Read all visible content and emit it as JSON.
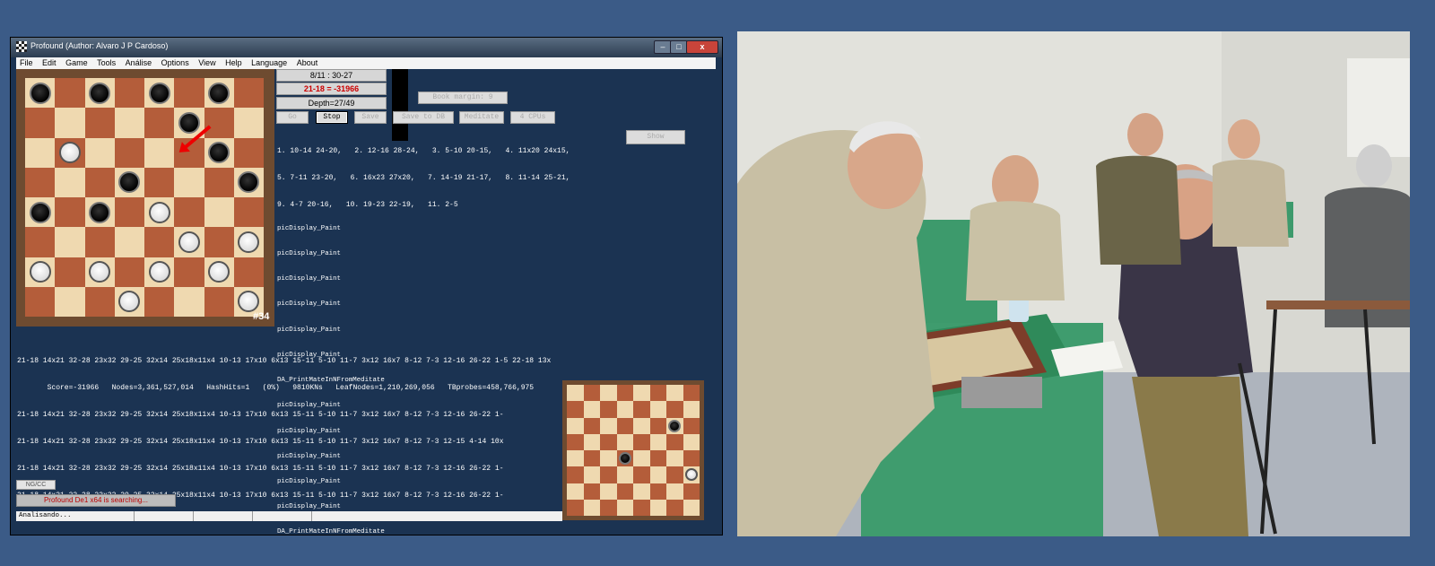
{
  "window": {
    "title": "Profound (Author: Alvaro J P Cardoso)",
    "close_label": "x",
    "min_label": "–",
    "max_label": "□"
  },
  "menu": [
    "File",
    "Edit",
    "Game",
    "Tools",
    "Análise",
    "Options",
    "View",
    "Help",
    "Language",
    "About"
  ],
  "board_main": {
    "move_number": "#34",
    "rows": [
      [
        "b",
        ".",
        "b",
        ".",
        "b",
        ".",
        "b",
        "."
      ],
      [
        ".",
        ".",
        ".",
        ".",
        ".",
        "b",
        ".",
        "."
      ],
      [
        ".",
        "w",
        ".",
        ".",
        ".",
        ".",
        "b",
        "."
      ],
      [
        ".",
        ".",
        ".",
        "b",
        ".",
        ".",
        ".",
        "b"
      ],
      [
        "b",
        ".",
        "b",
        ".",
        "w",
        ".",
        ".",
        "."
      ],
      [
        ".",
        ".",
        ".",
        ".",
        ".",
        "w",
        ".",
        "w"
      ],
      [
        "w",
        ".",
        "w",
        ".",
        "w",
        ".",
        "w",
        "."
      ],
      [
        ".",
        ".",
        ".",
        "w",
        ".",
        ".",
        ".",
        "w"
      ]
    ]
  },
  "board_small": {
    "rows": [
      [
        ".",
        ".",
        ".",
        ".",
        ".",
        ".",
        ".",
        "."
      ],
      [
        ".",
        ".",
        ".",
        ".",
        ".",
        ".",
        ".",
        "."
      ],
      [
        ".",
        ".",
        ".",
        ".",
        ".",
        ".",
        "b",
        "."
      ],
      [
        ".",
        ".",
        ".",
        ".",
        ".",
        ".",
        ".",
        "."
      ],
      [
        ".",
        ".",
        ".",
        "b",
        ".",
        ".",
        ".",
        "."
      ],
      [
        ".",
        ".",
        ".",
        ".",
        ".",
        ".",
        ".",
        "w"
      ],
      [
        ".",
        ".",
        ".",
        ".",
        ".",
        ".",
        ".",
        "."
      ],
      [
        ".",
        ".",
        ".",
        ".",
        ".",
        ".",
        ".",
        "."
      ]
    ]
  },
  "info": {
    "position": "8/11 : 30-27",
    "score": "21-18 = -31966",
    "depth": "Depth=27/49",
    "book_margin": "Book margin: 9"
  },
  "colors": {
    "score": "#cc0000",
    "status": "#bb0000",
    "dark_square": "#b45d3a",
    "light_square": "#efd9b0"
  },
  "buttons": {
    "go": "Go",
    "stop": "Stop",
    "save": "Save",
    "save_db": "Save to DB",
    "meditate": "Meditate",
    "cpus": "4 CPUs",
    "show": "Show",
    "ngcc": "NG/CC"
  },
  "pv_lines": [
    "1. 10-14 24-20,   2. 12-16 28-24,   3. 5-10 20-15,   4. 11x20 24x15,",
    "5. 7-11 23-20,   6. 16x23 27x20,   7. 14-19 21-17,   8. 11-14 25-21,",
    "9. 4-7 20-16,   10. 19-23 22-19,   11. 2-5"
  ],
  "log_lines": [
    "picDisplay_Paint",
    "picDisplay_Paint",
    "picDisplay_Paint",
    "picDisplay_Paint",
    "picDisplay_Paint",
    "picDisplay_Paint",
    "DA_PrintMateInNFromMeditate",
    "picDisplay_Paint",
    "picDisplay_Paint",
    "picDisplay_Paint",
    "picDisplay_Paint",
    "picDisplay_Paint",
    "DA_PrintMateInNFromMeditate"
  ],
  "analysis_line1": "21-18 14x21 32-28 23x32 29-25 32x14 25x18x11x4 10-13 17x10 6x13 15-11 5-10 11-7 3x12 16x7 8-12 7-3 12-16 26-22 1-5 22-18 13x",
  "analysis_stats": "       Score=-31966   Nodes=3,361,527,014   HashHits=1   (0%)   9810KNs   LeafNodes=1,210,269,056   TBprobes=458,766,975",
  "analysis_lines": [
    "21-18 14x21 32-28 23x32 29-25 32x14 25x18x11x4 10-13 17x10 6x13 15-11 5-10 11-7 3x12 16x7 8-12 7-3 12-16 26-22 1-",
    "21-18 14x21 32-28 23x32 29-25 32x14 25x18x11x4 10-13 17x10 6x13 15-11 5-10 11-7 3x12 16x7 8-12 7-3 12-15 4-14 10x",
    "21-18 14x21 32-28 23x32 29-25 32x14 25x18x11x4 10-13 17x10 6x13 15-11 5-10 11-7 3x12 16x7 8-12 7-3 12-16 26-22 1-",
    "21-18 14x21 32-28 23x32 29-25 32x14 25x18x11x4 10-13 17x10 6x13 15-11 5-10 11-7 3x12 16x7 8-12 7-3 12-16 26-22 1-"
  ],
  "status_message": "Profound De1 x64 is searching...",
  "statusbar": {
    "text": "Analisando..."
  }
}
